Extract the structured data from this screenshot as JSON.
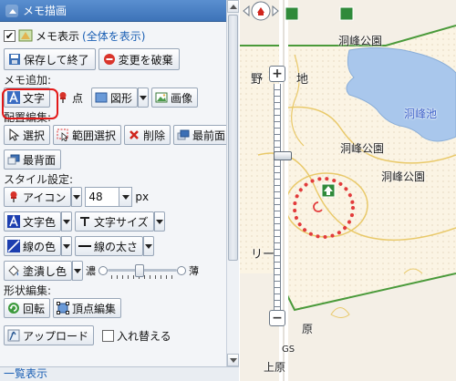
{
  "panel": {
    "title": "メモ描画",
    "memo_show_label": "メモ表示",
    "memo_show_link": "(全体を表示)",
    "save_exit": "保存して終了",
    "discard": "変更を破棄",
    "add_section": "メモ追加:",
    "text_btn": "文字",
    "point_btn": "点",
    "shape_btn": "図形",
    "image_btn": "画像",
    "layout_section": "配置編集:",
    "select_btn": "選択",
    "range_select_btn": "範囲選択",
    "delete_btn": "削除",
    "front_btn": "最前面",
    "back_btn": "最背面",
    "style_section": "スタイル設定:",
    "icon_select": "アイコン",
    "size_value": "48",
    "size_unit": "px",
    "text_color": "文字色",
    "text_size": "文字サイズ",
    "line_color": "線の色",
    "line_width": "線の太さ",
    "fill_color": "塗潰し色",
    "opacity_dark": "濃",
    "opacity_light": "薄",
    "opacity_level": 0.45,
    "shape_section": "形状編集:",
    "rotate_btn": "回転",
    "vertex_btn": "頂点編集",
    "upload_btn": "アップロード",
    "replace_label": "入れ替える"
  },
  "footer": {
    "list_link": "一覧表示"
  },
  "map": {
    "labels": {
      "park_top": "洞峰公園",
      "park_mid": "洞峰公園",
      "park_right": "洞峰公園",
      "pond": "洞峰池",
      "nora": "野",
      "chi": "地",
      "ri": "リー",
      "hara": "原",
      "gs": "GS",
      "kamihara": "上原"
    },
    "zoom_in": "+",
    "zoom_out": "−",
    "colors": {
      "pond": "#a9c7ec",
      "park": "#fbf3e6",
      "boundary": "#4a9a3a",
      "memo_dots": "#e23b3b"
    }
  }
}
